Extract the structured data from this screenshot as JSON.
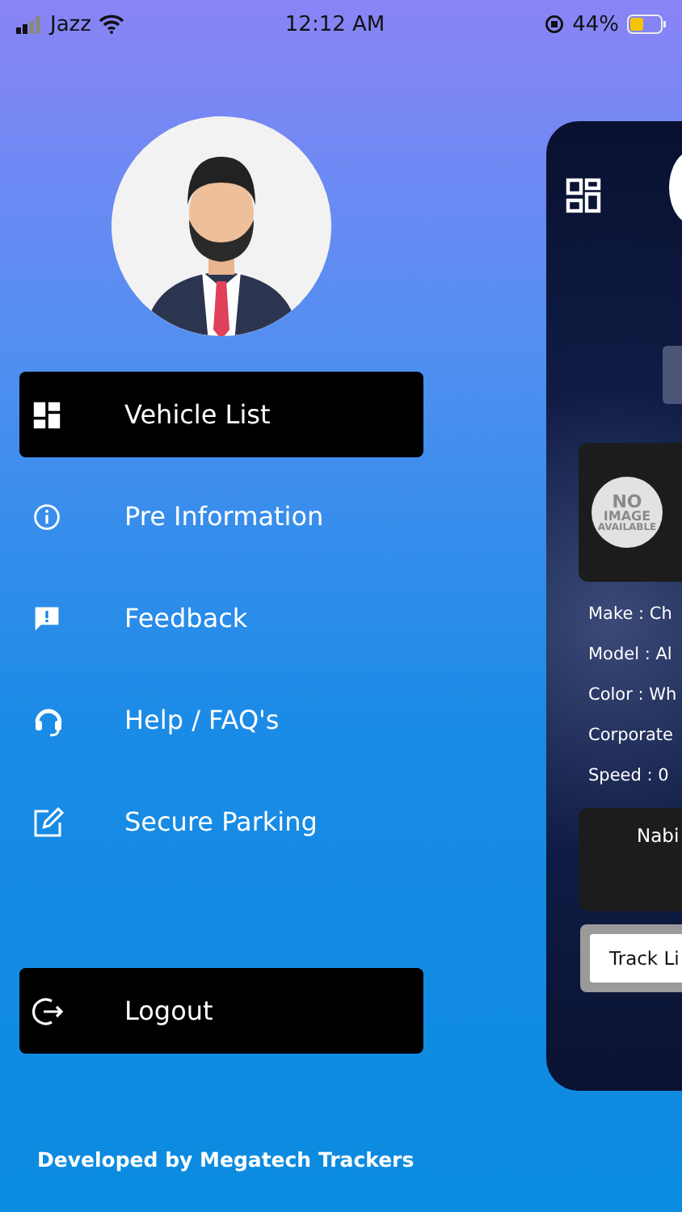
{
  "status_bar": {
    "carrier": "Jazz",
    "time": "12:12 AM",
    "battery": "44%"
  },
  "menu": [
    {
      "label": "Vehicle List",
      "selected": true
    },
    {
      "label": "Pre Information",
      "selected": false
    },
    {
      "label": "Feedback",
      "selected": false
    },
    {
      "label": "Help / FAQ's",
      "selected": false
    },
    {
      "label": "Secure Parking",
      "selected": false
    }
  ],
  "logout": {
    "label": "Logout"
  },
  "footer": "Developed by Megatech Trackers",
  "preview": {
    "no_image": [
      "NO",
      "IMAGE",
      "AVAILABLE"
    ],
    "details": [
      "Make : Ch",
      "Model : Al",
      "Color : Wh",
      "Corporate",
      "Speed : 0"
    ],
    "driver": "Nabi",
    "track_button": "Track Li"
  }
}
